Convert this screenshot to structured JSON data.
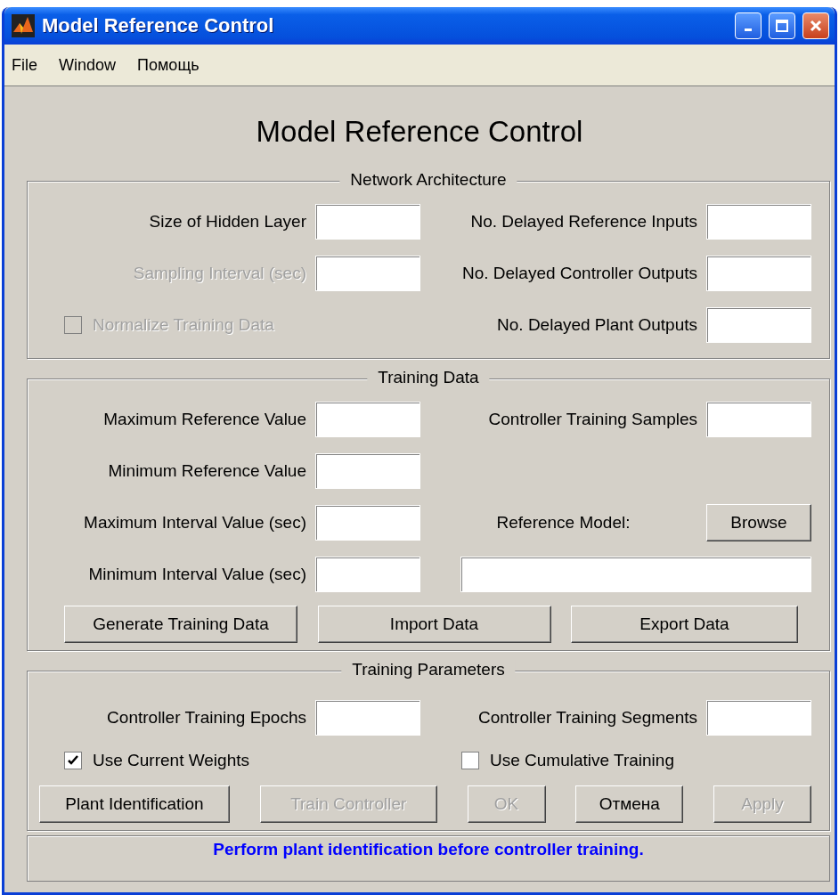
{
  "window": {
    "title": "Model Reference Control"
  },
  "menu": [
    "File",
    "Window",
    "Помощь"
  ],
  "heading": "Model Reference Control",
  "panels": [
    {
      "title": "Network Architecture",
      "rows": [
        {
          "kind": "grid",
          "items": [
            {
              "kind": "label",
              "text": "Size of Hidden Layer",
              "disabled": false
            },
            {
              "kind": "field"
            },
            {
              "kind": "label",
              "text": "No. Delayed Reference Inputs",
              "disabled": false
            },
            {
              "kind": "field"
            }
          ]
        },
        {
          "kind": "grid",
          "items": [
            {
              "kind": "label",
              "text": "Sampling Interval (sec)",
              "disabled": true
            },
            {
              "kind": "field"
            },
            {
              "kind": "label",
              "text": "No. Delayed Controller Outputs",
              "disabled": false
            },
            {
              "kind": "field"
            }
          ]
        },
        {
          "kind": "grid",
          "items": [
            {
              "kind": "checkbox",
              "text": "Normalize Training Data",
              "checked": false,
              "disabled": true
            },
            {
              "kind": "label",
              "text": "No. Delayed Plant Outputs",
              "disabled": false
            },
            {
              "kind": "field"
            }
          ]
        }
      ]
    },
    {
      "title": "Training Data",
      "rows": [
        {
          "kind": "grid",
          "items": [
            {
              "kind": "label",
              "text": "Maximum Reference Value",
              "disabled": false
            },
            {
              "kind": "field"
            },
            {
              "kind": "label",
              "text": "Controller Training Samples",
              "disabled": false
            },
            {
              "kind": "field"
            }
          ]
        },
        {
          "kind": "grid",
          "items": [
            {
              "kind": "label",
              "text": "Minimum Reference Value",
              "disabled": false
            },
            {
              "kind": "field"
            }
          ]
        },
        {
          "kind": "grid",
          "items": [
            {
              "kind": "label",
              "text": "Maximum Interval Value (sec)",
              "disabled": false
            },
            {
              "kind": "field"
            },
            {
              "kind": "caption",
              "text": "Reference Model:"
            },
            {
              "kind": "button",
              "text": "Browse",
              "disabled": false
            }
          ]
        },
        {
          "kind": "grid",
          "items": [
            {
              "kind": "label",
              "text": "Minimum Interval Value (sec)",
              "disabled": false
            },
            {
              "kind": "field"
            },
            {
              "kind": "wide_field"
            }
          ]
        },
        {
          "kind": "buttons",
          "items": [
            {
              "text": "Generate Training Data",
              "disabled": false
            },
            {
              "text": "Import Data",
              "disabled": false
            },
            {
              "text": "Export Data",
              "disabled": false
            }
          ]
        }
      ]
    },
    {
      "title": "Training Parameters",
      "rows": [
        {
          "kind": "grid",
          "items": [
            {
              "kind": "label",
              "text": "Controller Training Epochs",
              "disabled": false
            },
            {
              "kind": "field"
            },
            {
              "kind": "label",
              "text": "Controller Training Segments",
              "disabled": false
            },
            {
              "kind": "field"
            }
          ]
        },
        {
          "kind": "grid",
          "items": [
            {
              "kind": "checkbox",
              "text": "Use Current Weights",
              "checked": true,
              "disabled": false
            },
            {
              "kind": "checkbox",
              "text": "Use Cumulative Training",
              "checked": false,
              "disabled": false
            }
          ]
        },
        {
          "kind": "buttons",
          "items": [
            {
              "text": "Plant Identification",
              "disabled": false
            },
            {
              "text": "Train Controller",
              "disabled": true
            },
            {
              "text": "OK",
              "disabled": true
            },
            {
              "text": "Отмена",
              "disabled": false
            },
            {
              "text": "Apply",
              "disabled": true
            }
          ]
        }
      ]
    }
  ],
  "status": "Perform plant identification before controller training."
}
